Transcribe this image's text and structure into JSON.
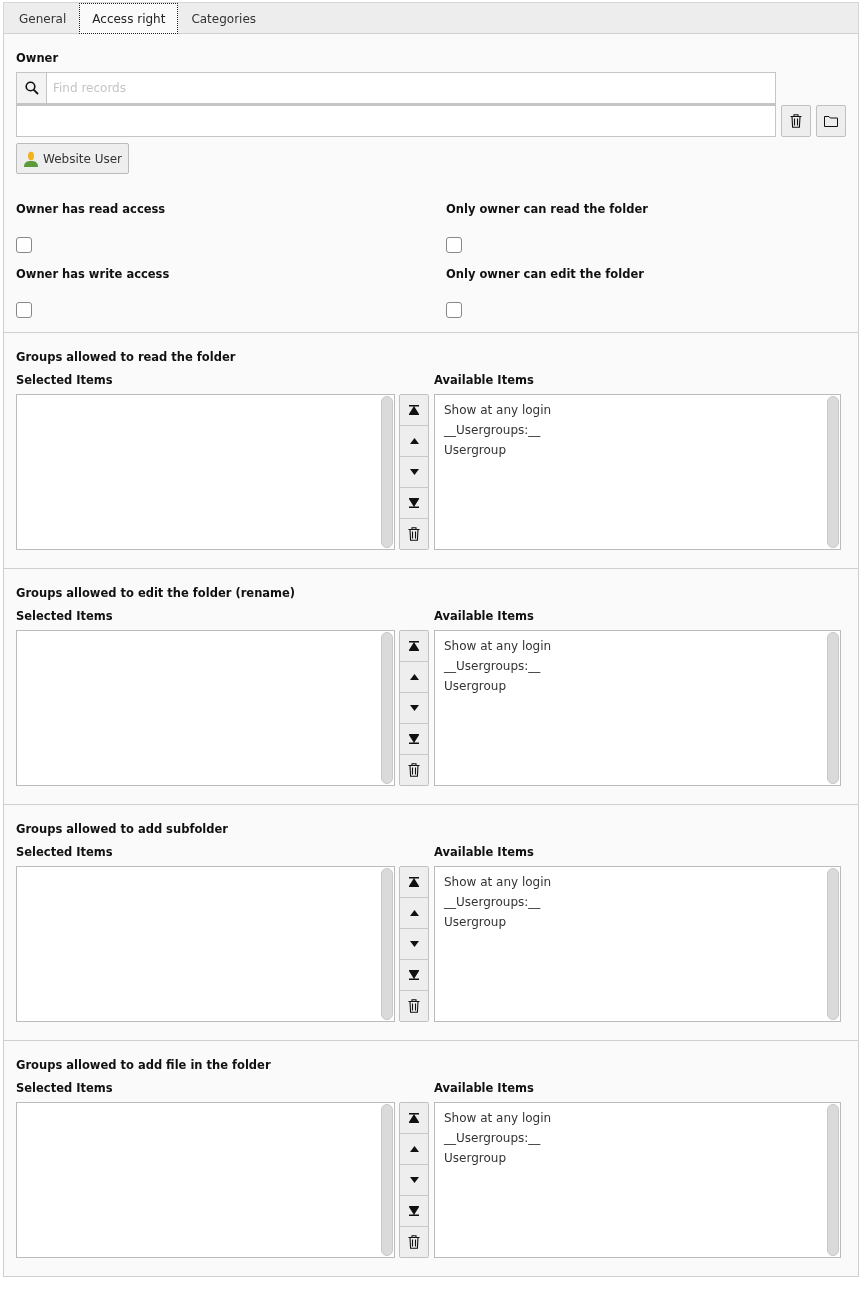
{
  "tabs": [
    {
      "label": "General",
      "selected": false
    },
    {
      "label": "Access right",
      "selected": true
    },
    {
      "label": "Categories",
      "selected": false
    }
  ],
  "owner": {
    "label": "Owner",
    "search": {
      "placeholder": "Find records"
    },
    "button": "Website User"
  },
  "checkboxes": [
    {
      "label": "Owner has read access",
      "checked": false
    },
    {
      "label": "Only owner can read the folder",
      "checked": false
    },
    {
      "label": "Owner has write access",
      "checked": false
    },
    {
      "label": "Only owner can edit the folder",
      "checked": false
    }
  ],
  "groups": [
    {
      "title": "Groups allowed to read the folder",
      "selected_label": "Selected Items",
      "available_label": "Available Items",
      "available": [
        "Show at any login",
        "__Usergroups:__",
        "Usergroup"
      ]
    },
    {
      "title": "Groups allowed to edit the folder (rename)",
      "selected_label": "Selected Items",
      "available_label": "Available Items",
      "available": [
        "Show at any login",
        "__Usergroups:__",
        "Usergroup"
      ]
    },
    {
      "title": "Groups allowed to add subfolder",
      "selected_label": "Selected Items",
      "available_label": "Available Items",
      "available": [
        "Show at any login",
        "__Usergroups:__",
        "Usergroup"
      ]
    },
    {
      "title": "Groups allowed to add file in the folder",
      "selected_label": "Selected Items",
      "available_label": "Available Items",
      "available": [
        "Show at any login",
        "__Usergroups:__",
        "Usergroup"
      ]
    }
  ]
}
